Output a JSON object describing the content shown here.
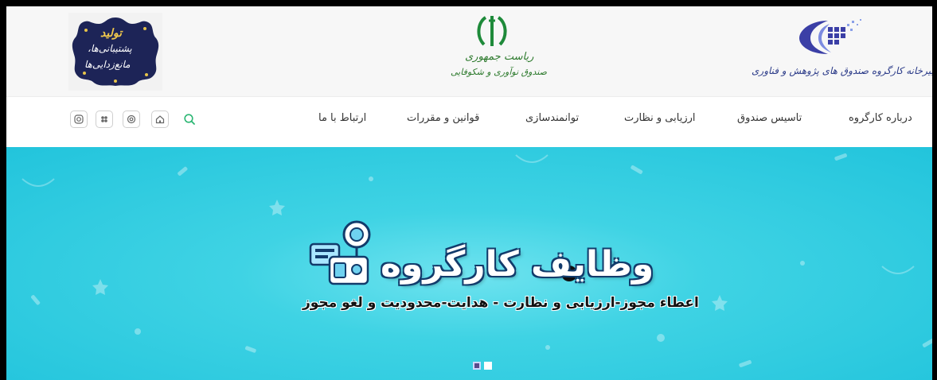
{
  "header": {
    "left_logo": {
      "name": "tolid-poshtibani-logo",
      "line1": "تولید",
      "line2": "پشتیبانی‌ها،",
      "line3": "مانع‌زدایی‌ها"
    },
    "center_logo": {
      "name": "iran-emblem-logo",
      "line1": "ریاست جمهوری",
      "line2": "صندوق نوآوری و شکوفایی"
    },
    "right_logo": {
      "name": "fund-secretariat-logo",
      "text": "دبیرخانه کارگروه صندوق های پژوهش و فناوری"
    }
  },
  "nav": {
    "items": [
      {
        "label": "درباره کارگروه"
      },
      {
        "label": "تاسیس صندوق"
      },
      {
        "label": "ارزیابی و نظارت"
      },
      {
        "label": "توانمندسازی"
      },
      {
        "label": "قوانین و مقررات"
      },
      {
        "label": "ارتباط با ما"
      }
    ],
    "social_icons": [
      "instagram-icon",
      "aparat-icon",
      "email-icon",
      "home-icon"
    ],
    "search_icon": "search-icon"
  },
  "hero": {
    "title": "وظایف کارگروه",
    "subtitle": "اعطاء مجوز-ارزیابی و نظارت - هدایت-محدودیت و لغو مجوز",
    "slides_count": 2,
    "active_slide": 1
  },
  "colors": {
    "hero_bg": "#2ccbe0",
    "title_outline": "#123b6b",
    "search_icon": "#2bb673",
    "dot_active": "#5b4a8a",
    "dot_inactive": "#ffffff"
  }
}
